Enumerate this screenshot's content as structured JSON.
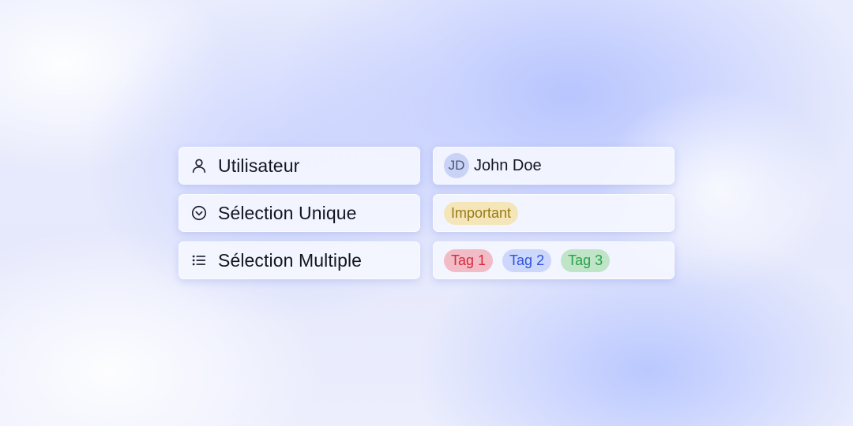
{
  "fields": [
    {
      "label": "Utilisateur",
      "icon": "user-icon"
    },
    {
      "label": "Sélection Unique",
      "icon": "chevron-circle-down-icon"
    },
    {
      "label": "Sélection Multiple",
      "icon": "list-icon"
    }
  ],
  "user_value": {
    "initials": "JD",
    "name": "John Doe"
  },
  "single_select_value": {
    "label": "Important",
    "color": "#f4e6b8"
  },
  "multi_select_values": [
    {
      "label": "Tag 1",
      "color": "#f2bcc6"
    },
    {
      "label": "Tag 2",
      "color": "#ccd7fb"
    },
    {
      "label": "Tag 3",
      "color": "#bfe4c8"
    }
  ]
}
